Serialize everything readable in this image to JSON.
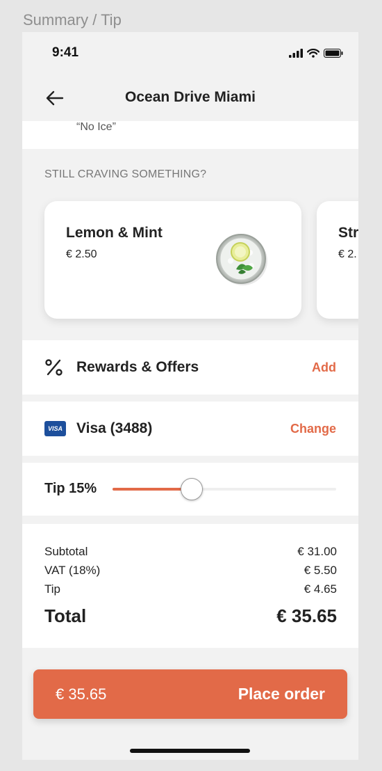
{
  "frame_label": "Summary / Tip",
  "status_bar": {
    "time": "9:41"
  },
  "header": {
    "title": "Ocean Drive Miami"
  },
  "order_note": "“No Ice”",
  "upsell": {
    "section_title": "STILL CRAVING SOMETHING?",
    "items": [
      {
        "name": "Lemon & Mint",
        "price": "€ 2.50"
      },
      {
        "name": "Str",
        "price": "€ 2."
      }
    ]
  },
  "rewards": {
    "label": "Rewards & Offers",
    "action": "Add",
    "icon": "percent-icon"
  },
  "payment": {
    "card_badge": "VISA",
    "label": "Visa (3488)",
    "action": "Change"
  },
  "tip": {
    "label": "Tip 15%",
    "slider_fraction": 0.35
  },
  "summary": {
    "subtotal_label": "Subtotal",
    "subtotal_value": "€ 31.00",
    "vat_label": "VAT (18%)",
    "vat_value": "€ 5.50",
    "tip_label": "Tip",
    "tip_value": "€ 4.65",
    "total_label": "Total",
    "total_value": "€ 35.65"
  },
  "cta": {
    "price": "€ 35.65",
    "label": "Place order"
  },
  "colors": {
    "accent": "#e26a48",
    "visa_blue": "#1d4f9c",
    "background": "#f2f2f2"
  }
}
